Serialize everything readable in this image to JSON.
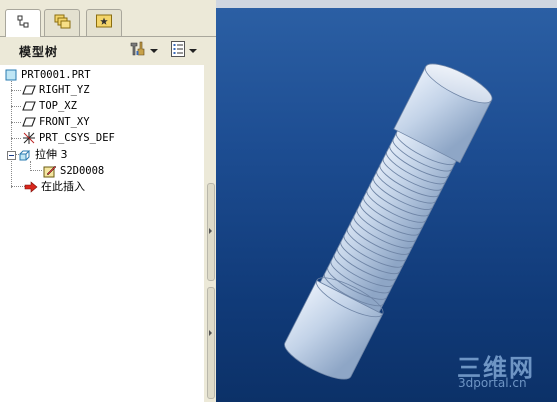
{
  "tabs": [
    {
      "name": "model-tree-tab",
      "icon": "model-tree-icon",
      "active": true
    },
    {
      "name": "folder-browser-tab",
      "icon": "folders-icon",
      "active": false
    },
    {
      "name": "favorites-tab",
      "icon": "favorites-star-icon",
      "active": false
    }
  ],
  "model_tree_header": {
    "title": "模型树",
    "settings_icon": "tools-icon",
    "show_icon": "list-icon"
  },
  "tree": {
    "root": {
      "label": "PRT0001.PRT",
      "icon": "part-icon"
    },
    "items": [
      {
        "label": "RIGHT_YZ",
        "icon": "datum-plane-icon"
      },
      {
        "label": "TOP_XZ",
        "icon": "datum-plane-icon"
      },
      {
        "label": "FRONT_XY",
        "icon": "datum-plane-icon"
      },
      {
        "label": "PRT_CSYS_DEF",
        "icon": "csys-icon"
      },
      {
        "label": "拉伸 3",
        "icon": "extrude-icon",
        "expanded": true
      },
      {
        "label": "S2D0008",
        "icon": "sketch-icon",
        "child": true
      },
      {
        "label": "在此插入",
        "icon": "insert-here-arrow-icon"
      }
    ]
  },
  "viewport": {
    "background_top": "#2b5fa4",
    "background_bottom": "#0c3168",
    "model": "threaded-cylinder",
    "model_color": "#c3d3e8"
  },
  "watermark": {
    "main": "三维网",
    "sub": "3dportal.cn"
  }
}
